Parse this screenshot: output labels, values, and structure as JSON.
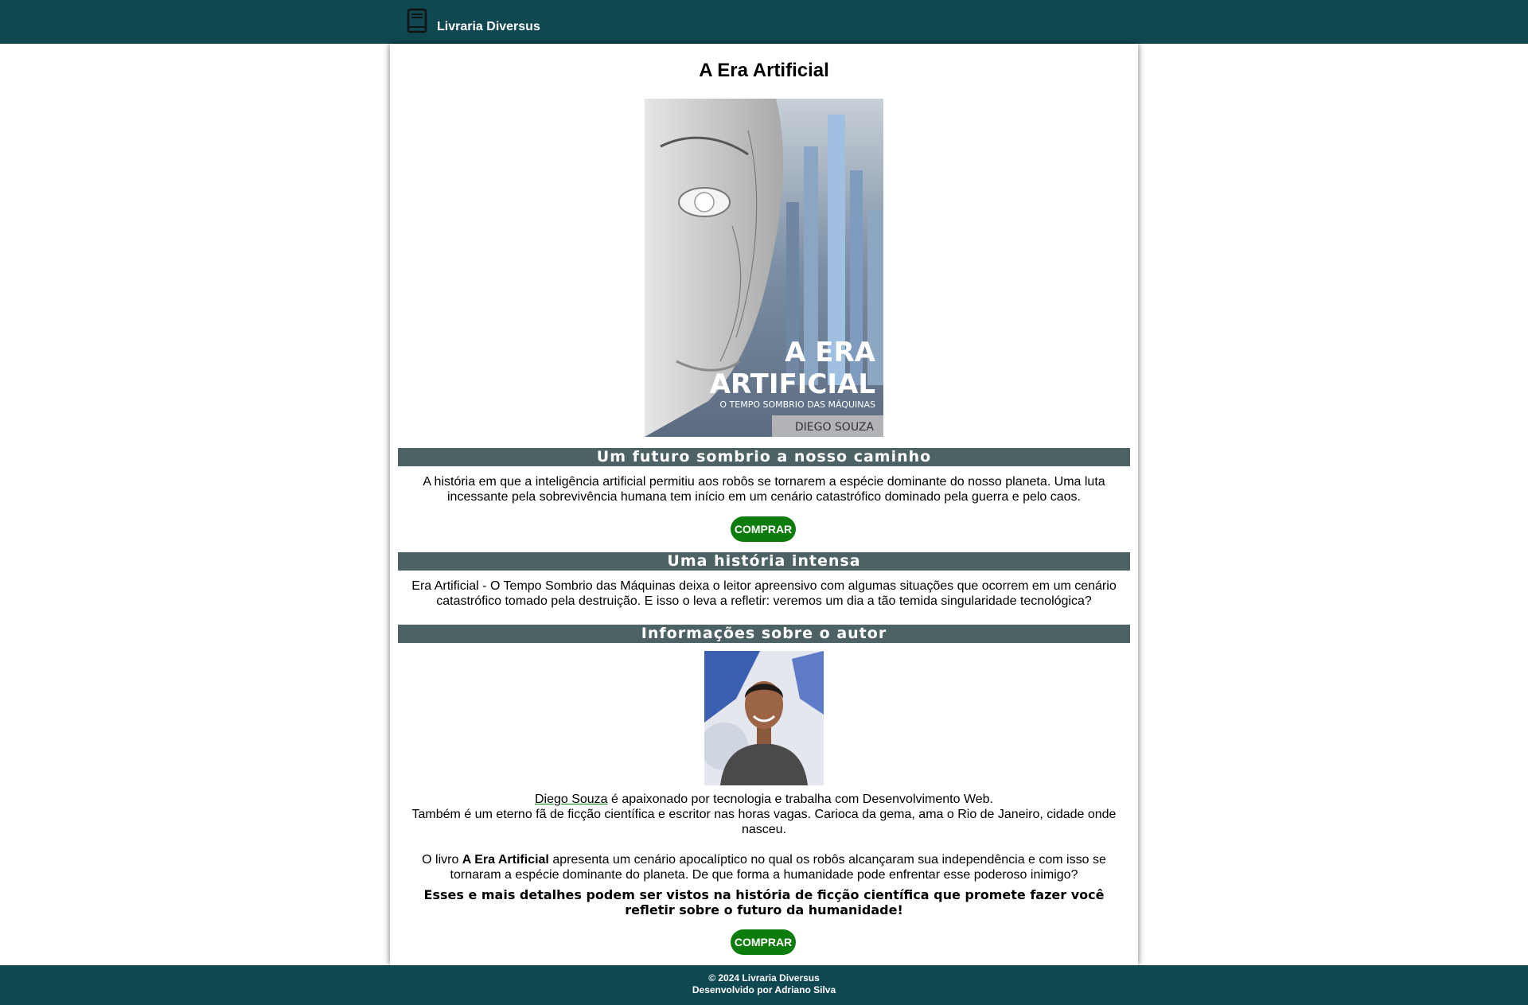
{
  "header": {
    "brand_name": "Livraria Diversus",
    "brand_icon": "book-icon",
    "background": "#104852"
  },
  "book": {
    "title": "A Era Artificial",
    "cover": {
      "title_line1": "A ERA",
      "title_line2": "ARTIFICIAL",
      "subtitle": "O TEMPO SOMBRIO DAS MÁQUINAS",
      "author": "DIEGO SOUZA"
    }
  },
  "sections": {
    "future": {
      "heading": "Um futuro sombrio a nosso caminho",
      "text": "A história em que a inteligência artificial permitiu aos robôs se tornarem a espécie dominante do nosso planeta. Uma luta incessante pela sobrevivência humana tem início em um cenário catastrófico dominado pela guerra e pelo caos."
    },
    "story": {
      "heading": "Uma história intensa",
      "text": "Era Artificial - O Tempo Sombrio das Máquinas deixa o leitor apreensivo com algumas situações que ocorrem em um cenário catastrófico tomado pela destruição. E isso o leva a refletir: veremos um dia a tão temida singularidade tecnológica?"
    },
    "author": {
      "heading": "Informações sobre o autor",
      "name_link": "Diego Souza",
      "bio_rest": " é apaixonado por tecnologia e trabalha com Desenvolvimento Web.",
      "bio_line2": "Também é um eterno fã de ficção científica e escritor nas horas vagas. Carioca da gema, ama o Rio de Janeiro, cidade onde nasceu.",
      "book_prefix": "O livro ",
      "book_name": "A Era Artificial",
      "book_rest": " apresenta um cenário apocalíptico no qual os robôs alcançaram sua independência e com isso se tornaram a espécie dominante do planeta. De que forma a humanidade pode enfrentar esse poderoso inimigo?",
      "closing": "Esses e mais detalhes podem ser vistos na história de ficção científica que promete fazer você refletir sobre o futuro da humanidade!"
    }
  },
  "buttons": {
    "buy_label": "COMPRAR",
    "color": "#0c7d0c"
  },
  "footer": {
    "copyright": "© 2024 Livraria Diversus",
    "credit": "Desenvolvido por Adriano Silva"
  }
}
